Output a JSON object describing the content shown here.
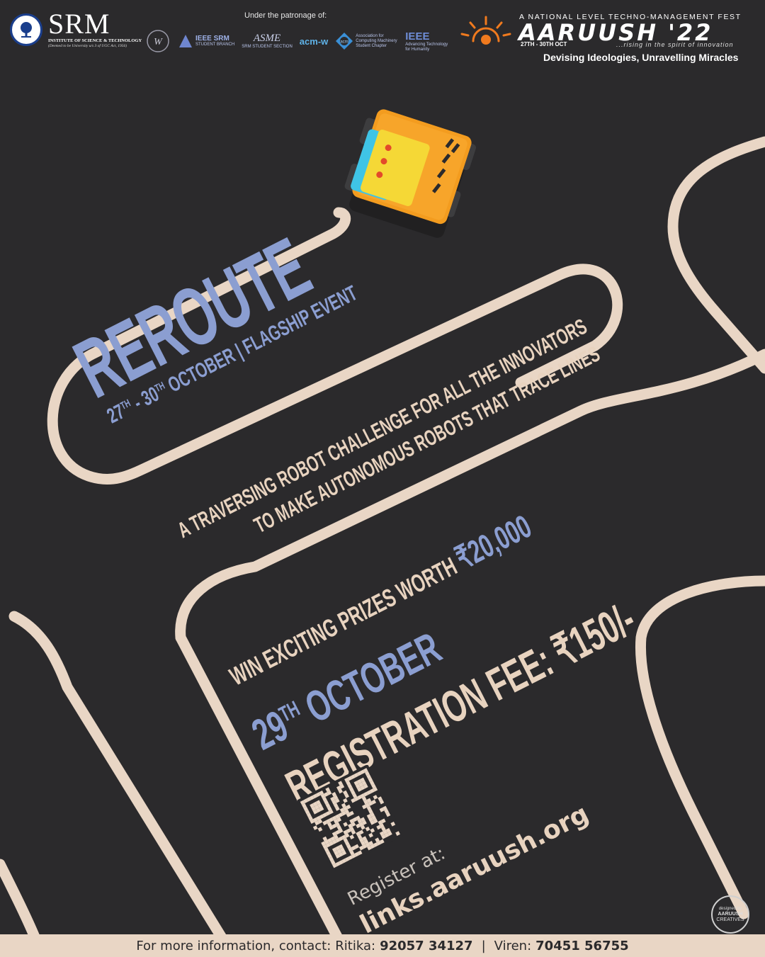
{
  "header": {
    "srm": {
      "name": "SRM",
      "line1": "INSTITUTE OF SCIENCE & TECHNOLOGY",
      "line2": "(Deemed to be University u/s 3 of UGC Act, 1956)"
    },
    "patronage_label": "Under the patronage of:",
    "patrons": [
      {
        "name": "IEEE SRM",
        "sub": "STUDENT BRANCH"
      },
      {
        "name": "ASME",
        "sub": "SRM STUDENT SECTION"
      },
      {
        "name": "acm-w",
        "sub": ""
      },
      {
        "name": "acm",
        "sub": "Association for Computing Machinery Student Chapter"
      },
      {
        "name": "IEEE",
        "sub": "Advancing Technology for Humanity"
      }
    ],
    "aaruush": {
      "tagline": "A NATIONAL LEVEL TECHNO-MANAGEMENT FEST",
      "name": "AARUUSH '22",
      "dates": "27TH - 30TH OCT",
      "slogan": "...rising in the spirit of innovation",
      "motto": "Devising Ideologies, Unravelling Miracles"
    }
  },
  "event": {
    "title": "REROUTE",
    "date_start": "27",
    "date_start_suffix": "TH",
    "date_sep": " - ",
    "date_end": "30",
    "date_end_suffix": "TH",
    "date_rest": " OCTOBER | FLAGSHIP EVENT",
    "description_line1": "A TRAVERSING ROBOT CHALLENGE FOR ALL THE INNOVATORS",
    "description_line2": "TO MAKE AUTONOMOUS ROBOTS THAT TRACE LINES",
    "prizes_text": "WIN EXCITING PRIZES WORTH ",
    "prizes_amount": "₹20,000",
    "event_day": "29",
    "event_day_suffix": "TH",
    "event_month": " OCTOBER",
    "registration_fee": "REGISTRATION FEE: ₹150/-"
  },
  "register": {
    "label": "Register at:",
    "url": "links.aaruush.org"
  },
  "credit": {
    "line1": "designed by",
    "line2": "AARUUSH",
    "line3": "CREATIVES"
  },
  "footer": {
    "prefix": "For more information, contact:",
    "contact1_name": "Ritika:",
    "contact1_phone": "92057 34127",
    "separator": "|",
    "contact2_name": "Viren:",
    "contact2_phone": "70451 56755"
  },
  "colors": {
    "background": "#2b2a2c",
    "track": "#e9d6c5",
    "accent_blue": "#8b9ed1",
    "robot_orange": "#f7a52a",
    "robot_yellow": "#f5d836",
    "robot_cyan": "#3fc4e6"
  }
}
